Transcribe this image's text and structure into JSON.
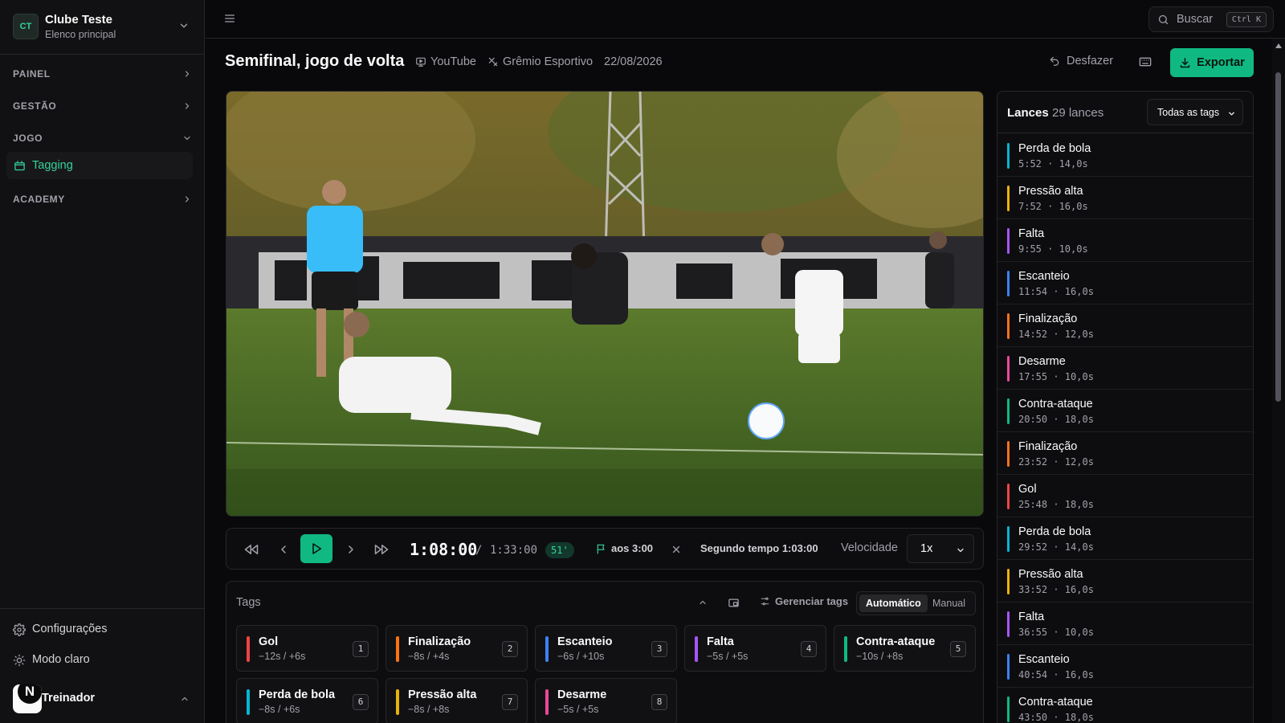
{
  "sidebar": {
    "club": {
      "initials": "CT",
      "name": "Clube Teste",
      "subtitle": "Elenco principal"
    },
    "sections": [
      {
        "label": "PAINEL"
      },
      {
        "label": "GESTÃO"
      },
      {
        "label": "JOGO"
      },
      {
        "label": "ACADEMY"
      }
    ],
    "active_item": {
      "label": "Tagging"
    },
    "bottom": {
      "settings": "Configurações",
      "theme": "Modo claro"
    },
    "user": {
      "initial": "N",
      "name": "Treinador"
    }
  },
  "topbar": {
    "search_label": "Buscar",
    "search_shortcut": "Ctrl K"
  },
  "match": {
    "title": "Semifinal, jogo de volta",
    "source": "YouTube",
    "opponent": "Grêmio Esportivo",
    "date": "22/08/2026",
    "undo_label": "Desfazer",
    "export_label": "Exportar"
  },
  "player": {
    "current_time": "1:08:00",
    "separator": "/",
    "total_time": "1:33:00",
    "match_minute": "51'",
    "marker_label": "aos 3:00",
    "period_label": "Segundo tempo 1:03:00",
    "speed_label": "Velocidade",
    "speed_value": "1x"
  },
  "tags_panel": {
    "title": "Tags",
    "manage_label": "Gerenciar tags",
    "mode_auto": "Automático",
    "mode_manual": "Manual",
    "tags": [
      {
        "name": "Gol",
        "range": "−12s / +6s",
        "key": "1",
        "color": "#ef4444"
      },
      {
        "name": "Finalização",
        "range": "−8s / +4s",
        "key": "2",
        "color": "#f97316"
      },
      {
        "name": "Escanteio",
        "range": "−6s / +10s",
        "key": "3",
        "color": "#3b82f6"
      },
      {
        "name": "Falta",
        "range": "−5s / +5s",
        "key": "4",
        "color": "#a855f7"
      },
      {
        "name": "Contra-ataque",
        "range": "−10s / +8s",
        "key": "5",
        "color": "#10b981"
      },
      {
        "name": "Perda de bola",
        "range": "−8s / +6s",
        "key": "6",
        "color": "#06b6d4"
      },
      {
        "name": "Pressão alta",
        "range": "−8s / +8s",
        "key": "7",
        "color": "#eab308"
      },
      {
        "name": "Desarme",
        "range": "−5s / +5s",
        "key": "8",
        "color": "#ec4899"
      }
    ]
  },
  "lances_panel": {
    "title": "Lances",
    "count": "29 lances",
    "filter_value": "Todas as tags",
    "items": [
      {
        "name": "Perda de bola",
        "time": "5:52 · 14,0s",
        "color": "#06b6d4"
      },
      {
        "name": "Pressão alta",
        "time": "7:52 · 16,0s",
        "color": "#eab308"
      },
      {
        "name": "Falta",
        "time": "9:55 · 10,0s",
        "color": "#a855f7"
      },
      {
        "name": "Escanteio",
        "time": "11:54 · 16,0s",
        "color": "#3b82f6"
      },
      {
        "name": "Finalização",
        "time": "14:52 · 12,0s",
        "color": "#f97316"
      },
      {
        "name": "Desarme",
        "time": "17:55 · 10,0s",
        "color": "#ec4899"
      },
      {
        "name": "Contra-ataque",
        "time": "20:50 · 18,0s",
        "color": "#10b981"
      },
      {
        "name": "Finalização",
        "time": "23:52 · 12,0s",
        "color": "#f97316"
      },
      {
        "name": "Gol",
        "time": "25:48 · 18,0s",
        "color": "#ef4444"
      },
      {
        "name": "Perda de bola",
        "time": "29:52 · 14,0s",
        "color": "#06b6d4"
      },
      {
        "name": "Pressão alta",
        "time": "33:52 · 16,0s",
        "color": "#eab308"
      },
      {
        "name": "Falta",
        "time": "36:55 · 10,0s",
        "color": "#a855f7"
      },
      {
        "name": "Escanteio",
        "time": "40:54 · 16,0s",
        "color": "#3b82f6"
      },
      {
        "name": "Contra-ataque",
        "time": "43:50 · 18,0s",
        "color": "#10b981"
      }
    ]
  },
  "colors": {
    "accent": "#10b981",
    "background": "#09090b",
    "panel": "#0d0d10"
  }
}
